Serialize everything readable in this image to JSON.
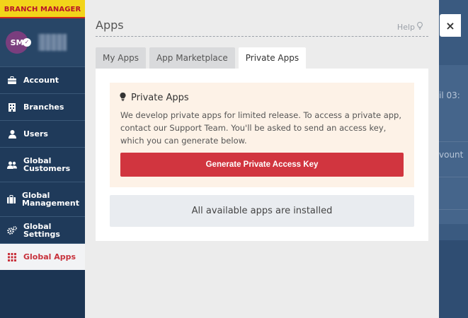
{
  "brand": {
    "label": "BRANCH MANAGER"
  },
  "user": {
    "initials": "SM"
  },
  "sidebar": {
    "items": [
      {
        "label": "Account",
        "icon": "briefcase-icon"
      },
      {
        "label": "Branches",
        "icon": "building-icon"
      },
      {
        "label": "Users",
        "icon": "user-icon"
      },
      {
        "label": "Global Customers",
        "icon": "users-icon"
      },
      {
        "label": "Global Management",
        "icon": "suitcase-icon"
      },
      {
        "label": "Global Settings",
        "icon": "gears-icon"
      },
      {
        "label": "Global Apps",
        "icon": "grid-icon",
        "active": true
      }
    ]
  },
  "background": {
    "texts": [
      "il 03:",
      "vount"
    ]
  },
  "modal": {
    "title": "Apps",
    "help_label": "Help",
    "close_label": "×",
    "tabs": [
      {
        "label": "My Apps"
      },
      {
        "label": "App Marketplace"
      },
      {
        "label": "Private Apps",
        "active": true
      }
    ],
    "info": {
      "title": "Private Apps",
      "text": "We develop private apps for limited release. To access a private app, contact our Support Team. You'll be asked to send an access key, which you can generate below.",
      "button_label": "Generate Private Access Key"
    },
    "installed_message": "All available apps are installed"
  },
  "colors": {
    "brand_yellow": "#f2d41a",
    "accent_red": "#d1353f",
    "sidebar_bg": "#1c3553",
    "info_bg": "#fdf2e7"
  }
}
